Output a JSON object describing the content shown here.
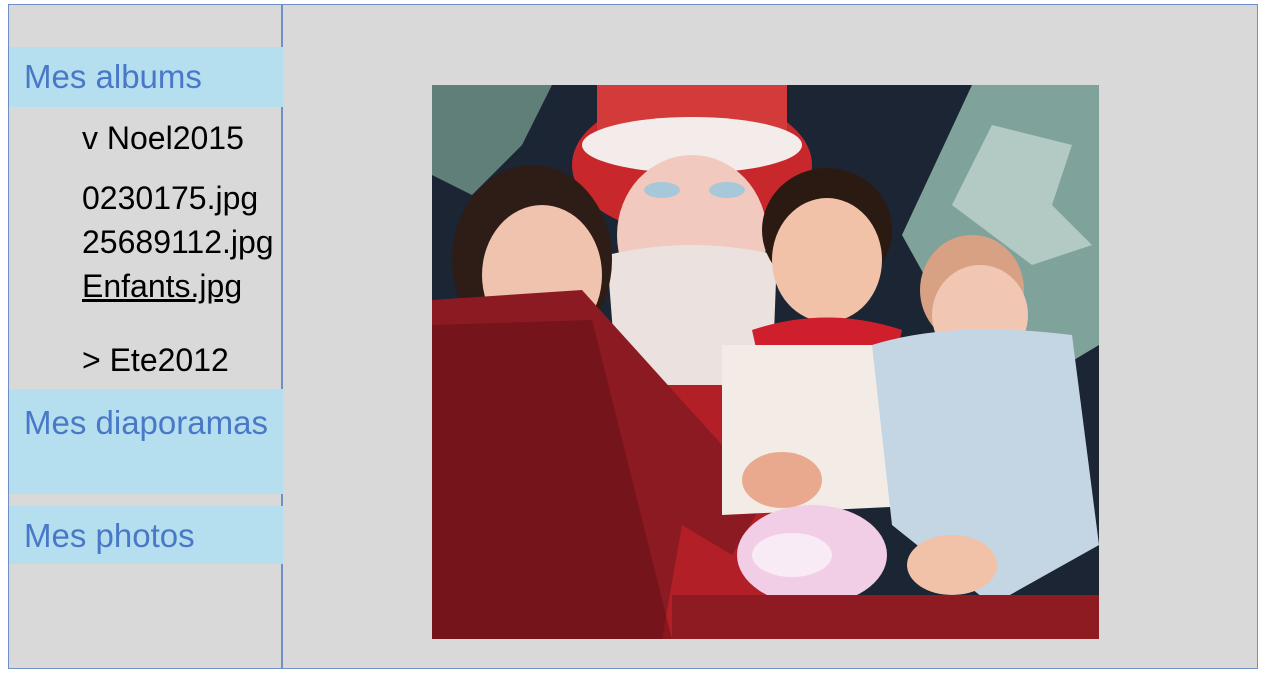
{
  "sidebar": {
    "albums_label": "Mes albums",
    "albums": [
      {
        "label": "v Noel2015",
        "expanded": true,
        "files": [
          "0230175.jpg",
          "25689112.jpg",
          "Enfants.jpg"
        ],
        "selected_file": "Enfants.jpg"
      },
      {
        "label": "> Ete2012",
        "expanded": false
      }
    ],
    "diaporamas_label": "Mes diaporamas",
    "photos_label": "Mes photos"
  },
  "viewer": {
    "content": "photo"
  },
  "colors": {
    "frame_bg": "#d9d9d9",
    "frame_border": "#6f8fc6",
    "nav_bg": "#b5dfee",
    "nav_text": "#4a78c8"
  }
}
